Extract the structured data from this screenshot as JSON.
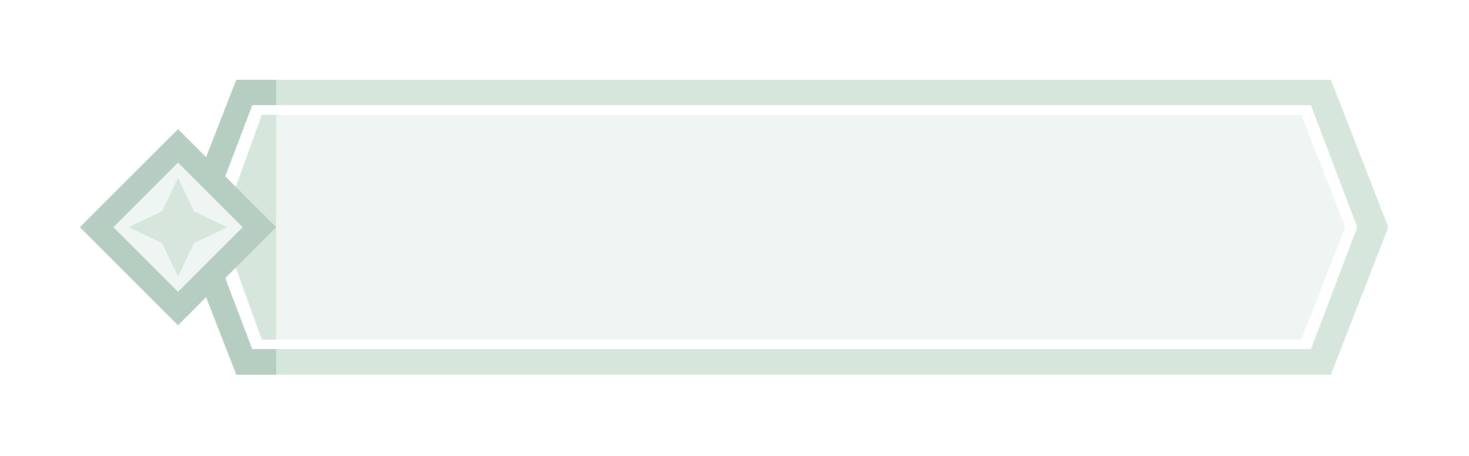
{
  "banner": {
    "colors": {
      "outer_fill": "#d6e6dd",
      "left_band": "#b6cdc2",
      "inner_stroke": "#ffffff",
      "inner_fill": "#eff5f2",
      "inner_left_band": "#d6e6dd",
      "diamond_outer": "#b6cdc2",
      "diamond_inner": "#eff5f2",
      "star_fill": "#d6e6dd"
    },
    "icon": "four-point-star-icon"
  }
}
